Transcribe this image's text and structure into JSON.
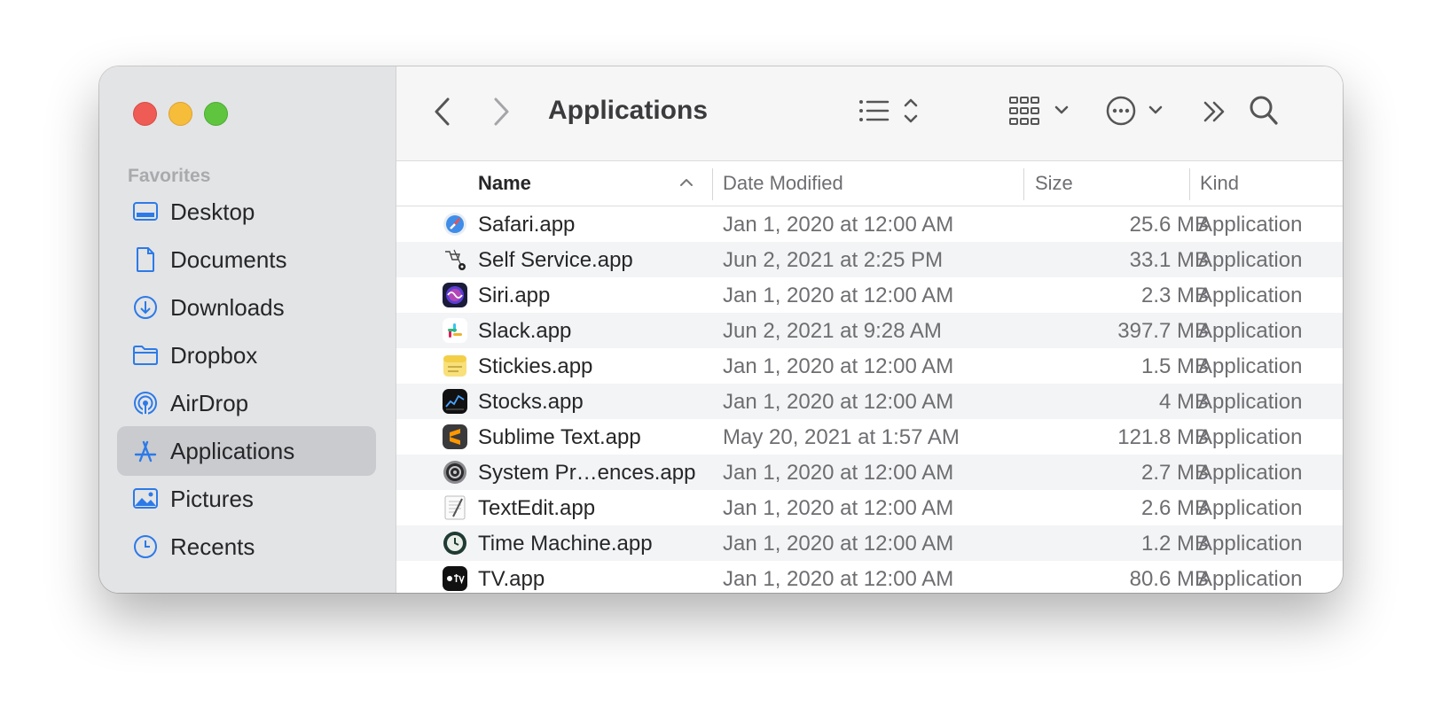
{
  "window": {
    "title": "Applications"
  },
  "sidebar": {
    "section_title": "Favorites",
    "items": [
      {
        "label": "Desktop",
        "icon": "desktop-icon"
      },
      {
        "label": "Documents",
        "icon": "document-icon"
      },
      {
        "label": "Downloads",
        "icon": "download-icon"
      },
      {
        "label": "Dropbox",
        "icon": "folder-icon"
      },
      {
        "label": "AirDrop",
        "icon": "airdrop-icon"
      },
      {
        "label": "Applications",
        "icon": "applications-icon",
        "selected": true
      },
      {
        "label": "Pictures",
        "icon": "pictures-icon"
      },
      {
        "label": "Recents",
        "icon": "clock-icon"
      }
    ]
  },
  "toolbar": {
    "back_icon": "chevron-left-icon",
    "forward_icon": "chevron-right-icon",
    "view_icon": "list-view-icon",
    "group_icon": "grid-icon",
    "action_icon": "more-icon",
    "overflow_icon": "double-chevron-icon",
    "search_icon": "search-icon"
  },
  "table": {
    "columns": [
      "Name",
      "Date Modified",
      "Size",
      "Kind"
    ],
    "sort_indicator": "chevron-up-icon",
    "rows": [
      {
        "name": "Safari.app",
        "date": "Jan 1, 2020 at 12:00 AM",
        "size": "25.6 MB",
        "kind": "Application",
        "icon": "safari-icon"
      },
      {
        "name": "Self Service.app",
        "date": "Jun 2, 2021 at 2:25 PM",
        "size": "33.1 MB",
        "kind": "Application",
        "icon": "self-service-icon"
      },
      {
        "name": "Siri.app",
        "date": "Jan 1, 2020 at 12:00 AM",
        "size": "2.3 MB",
        "kind": "Application",
        "icon": "siri-icon"
      },
      {
        "name": "Slack.app",
        "date": "Jun 2, 2021 at 9:28 AM",
        "size": "397.7 MB",
        "kind": "Application",
        "icon": "slack-icon"
      },
      {
        "name": "Stickies.app",
        "date": "Jan 1, 2020 at 12:00 AM",
        "size": "1.5 MB",
        "kind": "Application",
        "icon": "stickies-icon"
      },
      {
        "name": "Stocks.app",
        "date": "Jan 1, 2020 at 12:00 AM",
        "size": "4 MB",
        "kind": "Application",
        "icon": "stocks-icon"
      },
      {
        "name": "Sublime Text.app",
        "date": "May 20, 2021 at 1:57 AM",
        "size": "121.8 MB",
        "kind": "Application",
        "icon": "sublime-text-icon"
      },
      {
        "name": "System Pr…ences.app",
        "date": "Jan 1, 2020 at 12:00 AM",
        "size": "2.7 MB",
        "kind": "Application",
        "icon": "system-preferences-icon"
      },
      {
        "name": "TextEdit.app",
        "date": "Jan 1, 2020 at 12:00 AM",
        "size": "2.6 MB",
        "kind": "Application",
        "icon": "textedit-icon"
      },
      {
        "name": "Time Machine.app",
        "date": "Jan 1, 2020 at 12:00 AM",
        "size": "1.2 MB",
        "kind": "Application",
        "icon": "time-machine-icon"
      },
      {
        "name": "TV.app",
        "date": "Jan 1, 2020 at 12:00 AM",
        "size": "80.6 MB",
        "kind": "Application",
        "icon": "tv-icon"
      }
    ]
  },
  "colors": {
    "accent": "#2c7ae8",
    "sidebar_bg": "#e3e4e6",
    "selected_bg": "#cacbce",
    "row_alt": "#f3f4f5"
  }
}
